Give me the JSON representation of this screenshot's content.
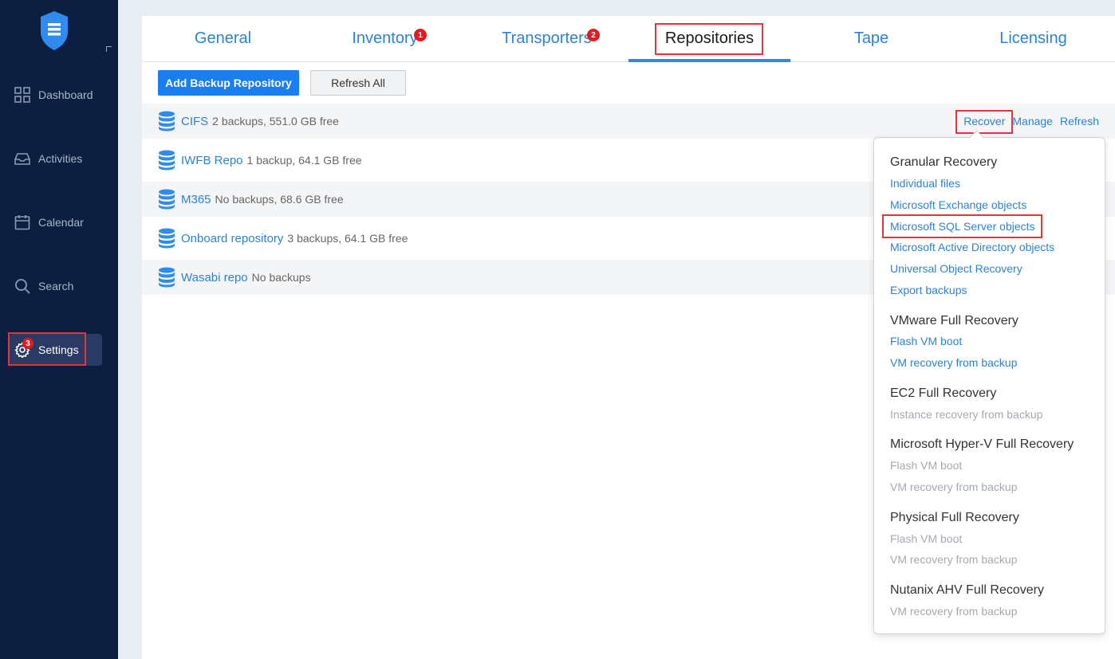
{
  "sidebar": {
    "items": [
      {
        "label": "Dashboard",
        "icon": "dashboard-icon"
      },
      {
        "label": "Activities",
        "icon": "inbox-icon"
      },
      {
        "label": "Calendar",
        "icon": "calendar-icon"
      },
      {
        "label": "Search",
        "icon": "search-icon"
      },
      {
        "label": "Settings",
        "icon": "gear-icon",
        "badge": "3"
      }
    ]
  },
  "tabs": [
    {
      "label": "General"
    },
    {
      "label": "Inventory",
      "badge": "1"
    },
    {
      "label": "Transporters",
      "badge": "2"
    },
    {
      "label": "Repositories"
    },
    {
      "label": "Tape"
    },
    {
      "label": "Licensing"
    }
  ],
  "toolbar": {
    "add_label": "Add Backup Repository",
    "refresh_label": "Refresh All"
  },
  "repositories": [
    {
      "name": "CIFS",
      "info": "2 backups, 551.0 GB free"
    },
    {
      "name": "IWFB Repo",
      "info": "1 backup, 64.1 GB free"
    },
    {
      "name": "M365",
      "info": "No backups, 68.6 GB free"
    },
    {
      "name": "Onboard repository",
      "info": "3 backups, 64.1 GB free"
    },
    {
      "name": "Wasabi repo",
      "info": "No backups"
    }
  ],
  "row_actions": {
    "recover": "Recover",
    "manage": "Manage",
    "refresh": "Refresh"
  },
  "recover_menu": {
    "granular": {
      "title": "Granular Recovery",
      "items": [
        "Individual files",
        "Microsoft Exchange objects",
        "Microsoft SQL Server objects",
        "Microsoft Active Directory objects",
        "Universal Object Recovery",
        "Export backups"
      ]
    },
    "vmware": {
      "title": "VMware Full Recovery",
      "items": [
        "Flash VM boot",
        "VM recovery from backup"
      ]
    },
    "ec2": {
      "title": "EC2 Full Recovery",
      "items": [
        "Instance recovery from backup"
      ]
    },
    "hyperv": {
      "title": "Microsoft Hyper-V Full Recovery",
      "items": [
        "Flash VM boot",
        "VM recovery from backup"
      ]
    },
    "physical": {
      "title": "Physical Full Recovery",
      "items": [
        "Flash VM boot",
        "VM recovery from backup"
      ]
    },
    "nutanix": {
      "title": "Nutanix AHV Full Recovery",
      "items": [
        "VM recovery from backup"
      ]
    }
  },
  "colors": {
    "sidebar_bg": "#0d1f40",
    "accent": "#2b83d6",
    "primary_button": "#1a7ef0",
    "highlight": "#e2363c",
    "badge": "#e21b22"
  }
}
